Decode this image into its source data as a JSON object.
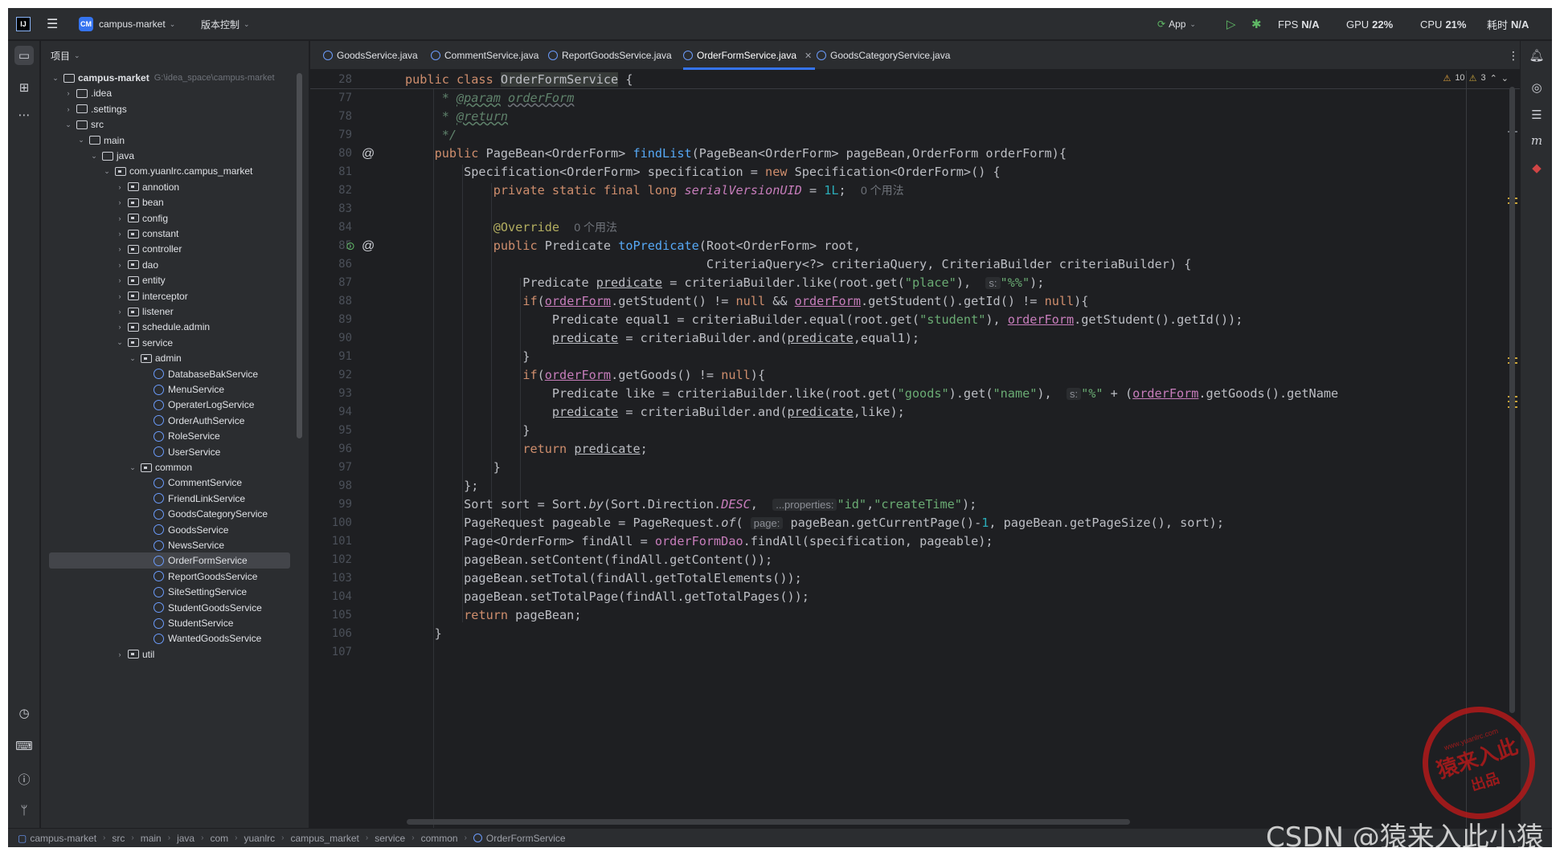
{
  "titlebar": {
    "project_badge": "CM",
    "project_name": "campus-market",
    "vcs": "版本控制",
    "run_config": "App",
    "fps_label": "FPS",
    "fps_value": "N/A",
    "gpu_label": "GPU",
    "gpu_value": "22%",
    "cpu_label": "CPU",
    "cpu_value": "21%",
    "time_label": "耗时",
    "time_value": "N/A"
  },
  "project_panel": {
    "title": "项目",
    "tree": [
      {
        "label": "campus-market",
        "hint": "G:\\idea_space\\campus-market",
        "kind": "module",
        "depth": 0,
        "open": true,
        "bold": true
      },
      {
        "label": ".idea",
        "kind": "folder",
        "depth": 1,
        "open": false
      },
      {
        "label": ".settings",
        "kind": "folder",
        "depth": 1,
        "open": false
      },
      {
        "label": "src",
        "kind": "folder",
        "depth": 1,
        "open": true
      },
      {
        "label": "main",
        "kind": "folder",
        "depth": 2,
        "open": true
      },
      {
        "label": "java",
        "kind": "folder",
        "depth": 3,
        "open": true
      },
      {
        "label": "com.yuanlrc.campus_market",
        "kind": "pkg",
        "depth": 4,
        "open": true
      },
      {
        "label": "annotion",
        "kind": "pkg",
        "depth": 5,
        "open": false
      },
      {
        "label": "bean",
        "kind": "pkg",
        "depth": 5,
        "open": false
      },
      {
        "label": "config",
        "kind": "pkg",
        "depth": 5,
        "open": false
      },
      {
        "label": "constant",
        "kind": "pkg",
        "depth": 5,
        "open": false
      },
      {
        "label": "controller",
        "kind": "pkg",
        "depth": 5,
        "open": false
      },
      {
        "label": "dao",
        "kind": "pkg",
        "depth": 5,
        "open": false
      },
      {
        "label": "entity",
        "kind": "pkg",
        "depth": 5,
        "open": false
      },
      {
        "label": "interceptor",
        "kind": "pkg",
        "depth": 5,
        "open": false
      },
      {
        "label": "listener",
        "kind": "pkg",
        "depth": 5,
        "open": false
      },
      {
        "label": "schedule.admin",
        "kind": "pkg",
        "depth": 5,
        "open": false
      },
      {
        "label": "service",
        "kind": "pkg",
        "depth": 5,
        "open": true
      },
      {
        "label": "admin",
        "kind": "pkg",
        "depth": 6,
        "open": true
      },
      {
        "label": "DatabaseBakService",
        "kind": "class",
        "depth": 7
      },
      {
        "label": "MenuService",
        "kind": "class",
        "depth": 7
      },
      {
        "label": "OperaterLogService",
        "kind": "class",
        "depth": 7
      },
      {
        "label": "OrderAuthService",
        "kind": "class",
        "depth": 7
      },
      {
        "label": "RoleService",
        "kind": "class",
        "depth": 7
      },
      {
        "label": "UserService",
        "kind": "class",
        "depth": 7
      },
      {
        "label": "common",
        "kind": "pkg",
        "depth": 6,
        "open": true
      },
      {
        "label": "CommentService",
        "kind": "class",
        "depth": 7
      },
      {
        "label": "FriendLinkService",
        "kind": "class",
        "depth": 7
      },
      {
        "label": "GoodsCategoryService",
        "kind": "class",
        "depth": 7
      },
      {
        "label": "GoodsService",
        "kind": "class",
        "depth": 7
      },
      {
        "label": "NewsService",
        "kind": "class",
        "depth": 7
      },
      {
        "label": "OrderFormService",
        "kind": "class",
        "depth": 7,
        "selected": true
      },
      {
        "label": "ReportGoodsService",
        "kind": "class",
        "depth": 7
      },
      {
        "label": "SiteSettingService",
        "kind": "class",
        "depth": 7
      },
      {
        "label": "StudentGoodsService",
        "kind": "class",
        "depth": 7
      },
      {
        "label": "StudentService",
        "kind": "class",
        "depth": 7
      },
      {
        "label": "WantedGoodsService",
        "kind": "class",
        "depth": 7
      },
      {
        "label": "util",
        "kind": "pkg",
        "depth": 5,
        "open": false
      }
    ]
  },
  "tabs": [
    {
      "label": "GoodsService.java",
      "active": false
    },
    {
      "label": "CommentService.java",
      "active": false
    },
    {
      "label": "ReportGoodsService.java",
      "active": false
    },
    {
      "label": "OrderFormService.java",
      "active": true
    },
    {
      "label": "GoodsCategoryService.java",
      "active": false
    }
  ],
  "editor": {
    "inspections": {
      "warnings": "10",
      "weak_warnings": "3"
    },
    "usage_hint": "0 个用法",
    "sticky_line": "28",
    "line_numbers": [
      "77",
      "78",
      "79",
      "80",
      "81",
      "82",
      "83",
      "84",
      "85",
      "86",
      "87",
      "88",
      "89",
      "90",
      "91",
      "92",
      "93",
      "94",
      "95",
      "96",
      "97",
      "98",
      "99",
      "100",
      "101",
      "102",
      "103",
      "104",
      "105",
      "106",
      "107"
    ],
    "inlay_s": "s:",
    "inlay_properties": "...properties:",
    "inlay_page": "page:"
  },
  "statusbar": {
    "breadcrumbs": [
      "campus-market",
      "src",
      "main",
      "java",
      "com",
      "yuanlrc",
      "campus_market",
      "service",
      "common",
      "OrderFormService"
    ]
  },
  "watermark": {
    "csdn": "CSDN @猿来入此小猿",
    "stamp_top": "www.yuanlrc.com",
    "stamp_mid": "猿来入此",
    "stamp_bot": "出品"
  }
}
